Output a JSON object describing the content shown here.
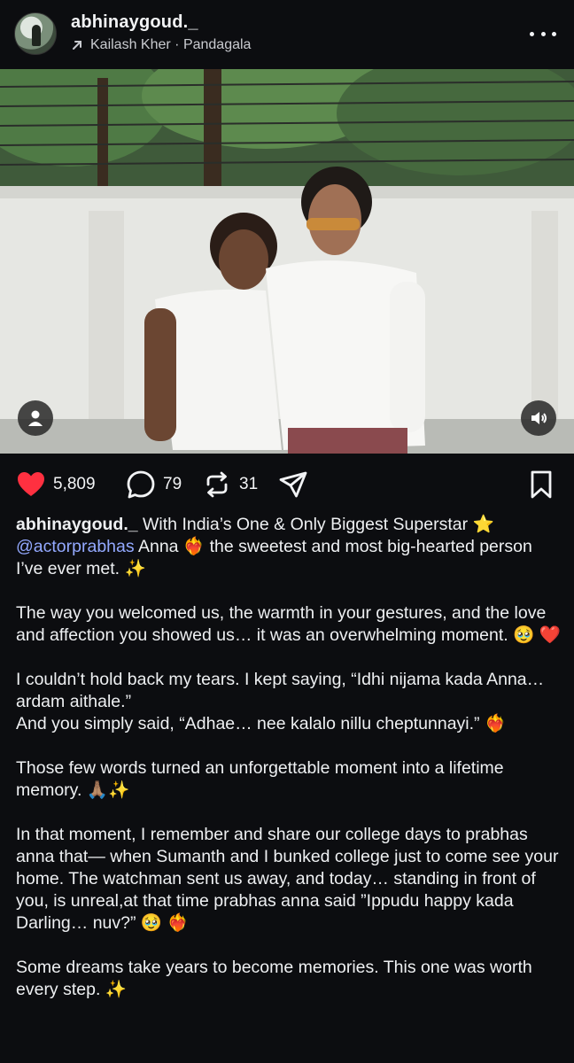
{
  "post": {
    "username": "abhinaygoud._",
    "music": "Kailash Kher · Pandagala",
    "likes": "5,809",
    "comments": "79",
    "reposts": "31"
  },
  "icons": {
    "more": "more-options-icon",
    "music": "arrow-up-right-icon",
    "like": "heart-filled-icon",
    "comment": "comment-icon",
    "repost": "repost-icon",
    "share": "share-icon",
    "bookmark": "bookmark-icon",
    "tag": "person-tag-icon",
    "sound": "speaker-icon"
  },
  "colors": {
    "background": "#0c0d10",
    "like": "#ff3040",
    "mention": "#93a9ff"
  },
  "caption": {
    "author": "abhinaygoud._",
    "p1_a": " With India’s One & Only Biggest Superstar ⭐ ",
    "mention": "@actorprabhas",
    "p1_b": " Anna ❤️‍🔥 the sweetest and most big-hearted person I’ve ever met. ✨",
    "p2": "The way you welcomed us, the warmth in your gestures, and the love and affection you showed us… it was an overwhelming moment. 🥹 ❤️",
    "p3_l1": "I couldn’t hold back my tears. I kept saying, “Idhi nijama kada Anna… ardam aithale.”",
    "p3_l2": "And you simply said, “Adhae… nee kalalo nillu cheptunnayi.” ❤️‍🔥",
    "p4": "Those few words turned an unforgettable moment into a lifetime memory. 🙏🏽✨",
    "p5": "In that moment, I remember and share our college days to prabhas anna that— when Sumanth and I bunked college just to come see your home. The watchman sent us away, and today… standing in front of you, is unreal,at that time prabhas anna said ”Ippudu happy kada Darling… nuv?” 🥹 ❤️‍🔥",
    "p6": "Some dreams take years to become memories. This one was worth every step. ✨"
  }
}
